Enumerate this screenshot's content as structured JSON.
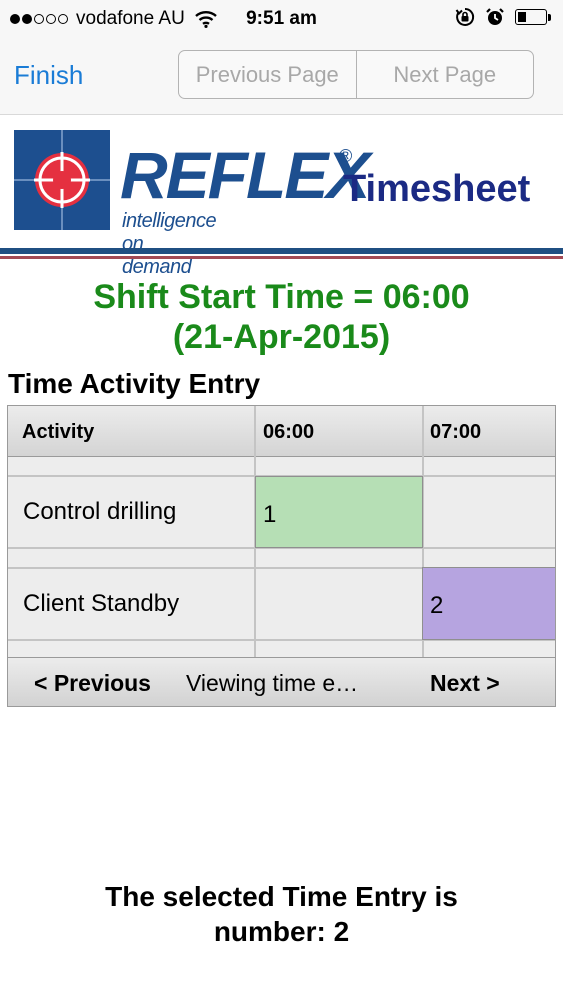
{
  "status_bar": {
    "carrier": "vodafone AU",
    "time": "9:51 am",
    "signal_bars_filled": 2,
    "signal_bars_total": 5,
    "battery_level": 0.3,
    "icons": [
      "wifi-icon",
      "orientation-lock-icon",
      "alarm-icon",
      "battery-icon"
    ]
  },
  "nav": {
    "finish_label": "Finish",
    "previous_page_label": "Previous Page",
    "next_page_label": "Next Page",
    "accent_color": "#1a7cd6"
  },
  "header": {
    "logo_word": "REFLEX",
    "logo_registered": "®",
    "logo_tagline": "intelligence on demand",
    "title": "Timesheet"
  },
  "shift": {
    "line1": "Shift Start Time = 06:00",
    "line2": "(21-Apr-2015)",
    "color": "#1a8a1a"
  },
  "section_title": "Time Activity Entry",
  "grid": {
    "columns": [
      "Activity",
      "06:00",
      "07:00"
    ],
    "rows": [
      {
        "activity": "Control drilling",
        "entries": [
          "1",
          ""
        ],
        "color": "#b6dfb5"
      },
      {
        "activity": "Client Standby",
        "entries": [
          "",
          "2"
        ],
        "color": "#b6a4e0"
      }
    ],
    "footer": {
      "previous_label": "< Previous",
      "status_text": "Viewing time e…",
      "next_label": "Next >"
    }
  },
  "selection": {
    "line1": "The selected Time Entry is",
    "line2": "number: 2"
  }
}
